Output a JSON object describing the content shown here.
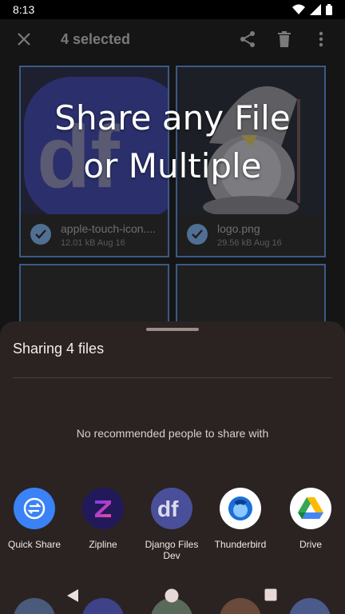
{
  "status_bar": {
    "time": "8:13"
  },
  "app_bar": {
    "title": "4 selected"
  },
  "files": [
    {
      "name": "apple-touch-icon....",
      "info": "12.01 kB Aug 16"
    },
    {
      "name": "logo.png",
      "info": "29.56 kB Aug 16"
    }
  ],
  "overlay": {
    "line1": "Share any File",
    "line2": "or Multiple"
  },
  "share_sheet": {
    "title": "Sharing 4 files",
    "no_people": "No recommended people to share with",
    "apps": [
      {
        "label": "Quick Share",
        "icon": "quick-share-icon",
        "color": "#3b82f6"
      },
      {
        "label": "Zipline",
        "icon": "zipline-icon",
        "color": "#22195a"
      },
      {
        "label": "Django Files Dev",
        "icon": "django-files-icon",
        "color": "#4a4f9a"
      },
      {
        "label": "Thunderbird",
        "icon": "thunderbird-icon",
        "color": "#ffffff"
      },
      {
        "label": "Drive",
        "icon": "drive-icon",
        "color": "#ffffff"
      }
    ]
  }
}
